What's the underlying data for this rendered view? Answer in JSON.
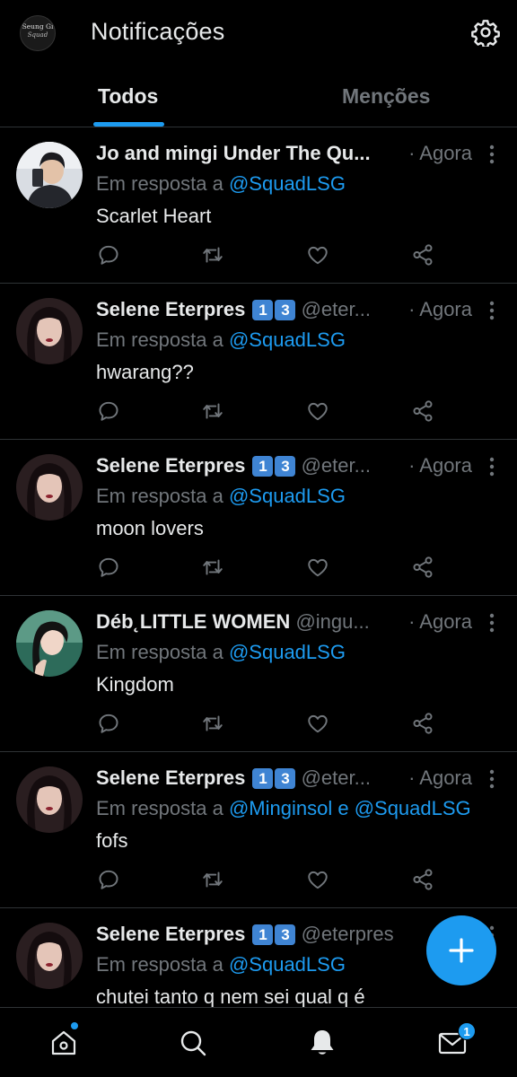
{
  "header": {
    "title": "Notificações",
    "logo_text_line1": "Seung Gi",
    "logo_text_line2": "Squad"
  },
  "tabs": [
    {
      "label": "Todos",
      "active": true
    },
    {
      "label": "Menções",
      "active": false
    }
  ],
  "reply_prefix": "Em resposta a",
  "notifications": [
    {
      "name": "Jo and mingi Under The Qu...",
      "badges": [],
      "handle": "",
      "time": "· Agora",
      "reply_to": "@SquadLSG",
      "text": "Scarlet Heart"
    },
    {
      "name": "Selene Eterpres",
      "badges": [
        "1",
        "3"
      ],
      "handle": "@eter...",
      "time": "· Agora",
      "reply_to": "@SquadLSG",
      "text": "hwarang??"
    },
    {
      "name": "Selene Eterpres",
      "badges": [
        "1",
        "3"
      ],
      "handle": "@eter...",
      "time": "· Agora",
      "reply_to": "@SquadLSG",
      "text": "moon lovers"
    },
    {
      "name": "Déb˛LITTLE WOMEN",
      "badges": [],
      "handle": "@ingu...",
      "time": "· Agora",
      "reply_to": "@SquadLSG",
      "text": "Kingdom"
    },
    {
      "name": "Selene Eterpres",
      "badges": [
        "1",
        "3"
      ],
      "handle": "@eter...",
      "time": "· Agora",
      "reply_to": "@Minginsol e @SquadLSG",
      "text": "fofs"
    },
    {
      "name": "Selene Eterpres",
      "badges": [
        "1",
        "3"
      ],
      "handle": "@eterpres",
      "time": "",
      "reply_to": "@SquadLSG",
      "text": "chutei tanto q nem sei qual q é"
    }
  ],
  "icons": {
    "settings": "gear-icon",
    "more": "more-vertical-icon",
    "reply": "reply-icon",
    "retweet": "retweet-icon",
    "like": "heart-icon",
    "share": "share-icon",
    "compose": "plus-icon",
    "home": "home-icon",
    "search": "search-icon",
    "notifications": "bell-icon",
    "messages": "mail-icon"
  },
  "bottom_nav": {
    "messages_badge": "1"
  },
  "colors": {
    "accent": "#1d9bf0",
    "background": "#000000",
    "muted": "#71767b",
    "badge": "#3f84d3"
  }
}
